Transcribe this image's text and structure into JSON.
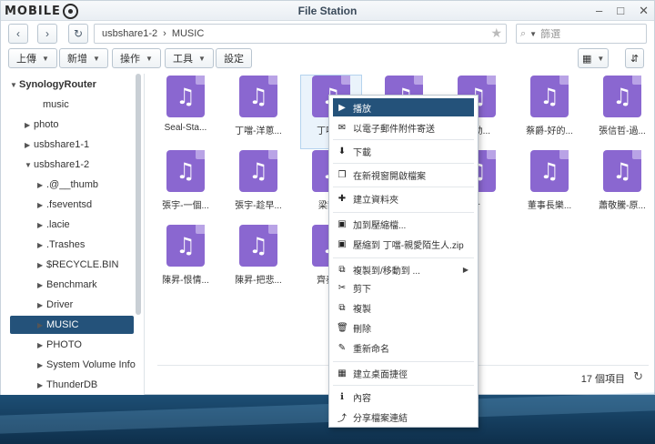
{
  "window": {
    "logo": "MOBILE",
    "title": "File Station",
    "minimize": "–",
    "maximize": "□",
    "close": "✕"
  },
  "nav": {
    "back": "‹",
    "forward": "›",
    "refresh": "↻",
    "path": [
      "usbshare1-2",
      "MUSIC"
    ],
    "path_sep": "›",
    "star": "★",
    "search_placeholder": "篩選"
  },
  "toolbar": {
    "upload": "上傳",
    "create": "新增",
    "action": "操作",
    "tools": "工具",
    "settings": "設定"
  },
  "sidebar": {
    "items": [
      {
        "label": "SynologyRouter",
        "arrow": "▼"
      },
      {
        "label": "music",
        "arrow": ""
      },
      {
        "label": "photo",
        "arrow": "▶"
      },
      {
        "label": "usbshare1-1",
        "arrow": "▶"
      },
      {
        "label": "usbshare1-2",
        "arrow": "▼"
      },
      {
        "label": ".@__thumb",
        "arrow": "▶"
      },
      {
        "label": ".fseventsd",
        "arrow": "▶"
      },
      {
        "label": ".lacie",
        "arrow": "▶"
      },
      {
        "label": ".Trashes",
        "arrow": "▶"
      },
      {
        "label": "$RECYCLE.BIN",
        "arrow": "▶"
      },
      {
        "label": "Benchmark",
        "arrow": "▶"
      },
      {
        "label": "Driver",
        "arrow": "▶"
      },
      {
        "label": "MUSIC",
        "arrow": "▶"
      },
      {
        "label": "PHOTO",
        "arrow": "▶"
      },
      {
        "label": "System Volume Info",
        "arrow": "▶"
      },
      {
        "label": "ThunderDB",
        "arrow": "▶"
      }
    ]
  },
  "files": [
    "Seal-Sta...",
    "丁噹-洋蔥...",
    "丁噹-...",
    "",
    "...-勁...",
    "蔡爵-好的...",
    "張信哲-過...",
    "張宇-一個...",
    "張宇-趁早...",
    "梁靜...",
    "",
    "...",
    "董事長樂...",
    "蕭敬騰-原...",
    "陳昇-恨情...",
    "陳昇-把悲...",
    "齊秦-..."
  ],
  "status": {
    "count": "17 個項目",
    "refresh": "↻"
  },
  "context_menu": {
    "items": [
      {
        "icon": "▶",
        "label": "播放"
      },
      {
        "icon": "✉",
        "label": "以電子郵件附件寄送"
      },
      {
        "icon": "⬇",
        "label": "下載"
      },
      {
        "icon": "❐",
        "label": "在新視窗開啟檔案"
      },
      {
        "icon": "✚",
        "label": "建立資料夾"
      },
      {
        "icon": "▣",
        "label": "加到壓縮檔..."
      },
      {
        "icon": "▣",
        "label": "壓縮到 丁噹-親愛陌生人.zip"
      },
      {
        "icon": "⧉",
        "label": "複製到/移動到 ..."
      },
      {
        "icon": "✂",
        "label": "剪下"
      },
      {
        "icon": "⧉",
        "label": "複製"
      },
      {
        "icon": "🗑",
        "label": "刪除"
      },
      {
        "icon": "✎",
        "label": "重新命名"
      },
      {
        "icon": "▦",
        "label": "建立桌面捷徑"
      },
      {
        "icon": "ℹ",
        "label": "內容"
      },
      {
        "icon": "⤴",
        "label": "分享檔案連結"
      }
    ],
    "submenu_arrow": "▶"
  },
  "colors": {
    "accent": "#24527a",
    "music_icon": "#8a67d0"
  }
}
